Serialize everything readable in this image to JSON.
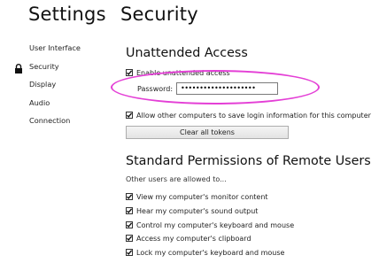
{
  "sidebar": {
    "title": "Settings",
    "items": [
      {
        "label": "User Interface"
      },
      {
        "label": "Security",
        "icon": "lock-icon"
      },
      {
        "label": "Display"
      },
      {
        "label": "Audio"
      },
      {
        "label": "Connection"
      }
    ]
  },
  "main": {
    "title": "Security",
    "unattended": {
      "heading": "Unattended Access",
      "enable_label": "Enable unattended access",
      "password_label": "Password:",
      "password_value": "••••••••••••••••••••",
      "allow_label": "Allow other computers to save login information for this computer",
      "clear_button": "Clear all tokens"
    },
    "permissions": {
      "heading": "Standard Permissions of Remote Users",
      "subtext": "Other users are allowed to...",
      "items": [
        {
          "label": "View my computer's monitor content"
        },
        {
          "label": "Hear my computer's sound output"
        },
        {
          "label": "Control my computer's keyboard and mouse"
        },
        {
          "label": "Access my computer's clipboard"
        },
        {
          "label": "Lock my computer's keyboard and mouse"
        }
      ]
    }
  },
  "colors": {
    "highlight": "#e43fd6",
    "text": "#1a1a1a"
  }
}
